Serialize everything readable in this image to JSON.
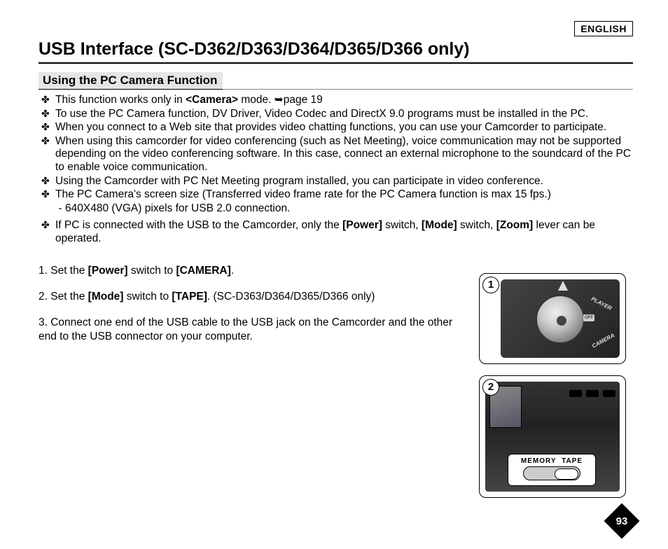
{
  "language_badge": "ENGLISH",
  "page_title": "USB Interface (SC-D362/D363/D364/D365/D366 only)",
  "section_title": "Using the PC Camera Function",
  "bullets": {
    "b1_pre": "This function works only in ",
    "b1_mode": "<Camera>",
    "b1_post": " mode. ",
    "b1_ref": "➥page 19",
    "b2": "To use the PC Camera function, DV Driver, Video Codec and DirectX 9.0 programs must be installed in the PC.",
    "b3": "When you connect to a Web site that provides video chatting functions, you can use your Camcorder to participate.",
    "b4": "When using this camcorder for video conferencing (such as Net Meeting), voice communication may not be supported depending on the video conferencing software. In this case, connect an external microphone to the soundcard of the PC to enable voice communication.",
    "b5": "Using the Camcorder with PC Net Meeting program installed, you can participate in video conference.",
    "b6": "The PC Camera's screen size (Transferred video frame rate for the PC Camera function is max 15 fps.)",
    "b6_sub": "640X480 (VGA) pixels for USB 2.0 connection.",
    "b7_pre": "If PC is connected with the USB to the Camcorder, only the ",
    "b7_power": "[Power]",
    "b7_mid1": " switch, ",
    "b7_mode": "[Mode]",
    "b7_mid2": " switch, ",
    "b7_zoom": "[Zoom]",
    "b7_post": " lever can be operated."
  },
  "steps": {
    "s1_pre": "1. Set the ",
    "s1_power": "[Power]",
    "s1_mid": " switch to ",
    "s1_camera": "[CAMERA]",
    "s1_post": ".",
    "s2_pre": "2. Set the ",
    "s2_mode": "[Mode]",
    "s2_mid": " switch to ",
    "s2_tape": "[TAPE]",
    "s2_post": ". (SC-D363/D364/D365/D366 only)",
    "s3": "3. Connect one end of the USB cable to the USB jack on the Camcorder and the other end to the USB connector on your computer."
  },
  "figures": {
    "fig1_num": "1",
    "fig1_player": "PLAYER",
    "fig1_camera": "CAMERA",
    "fig1_off": "OFF",
    "fig2_num": "2",
    "fig2_memory": "MEMORY",
    "fig2_tape": "TAPE"
  },
  "page_number": "93"
}
